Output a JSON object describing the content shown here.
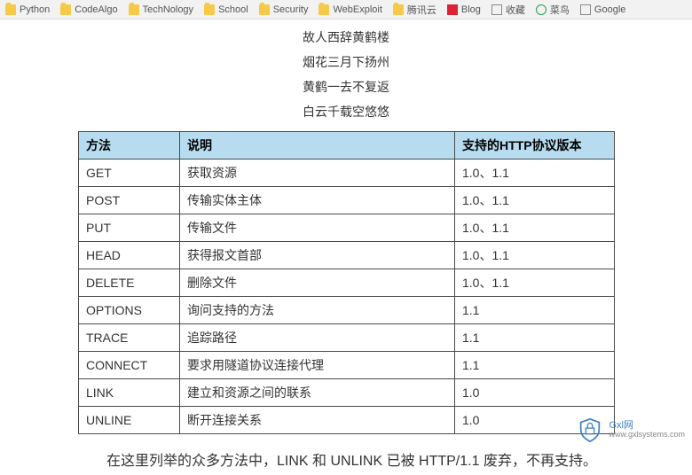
{
  "bookmarks": [
    {
      "name": "python",
      "label": "Python",
      "icon": "folder"
    },
    {
      "name": "codealgo",
      "label": "CodeAlgo",
      "icon": "folder"
    },
    {
      "name": "technology",
      "label": "TechNology",
      "icon": "folder"
    },
    {
      "name": "school",
      "label": "School",
      "icon": "folder"
    },
    {
      "name": "security",
      "label": "Security",
      "icon": "folder"
    },
    {
      "name": "webexploit",
      "label": "WebExploit",
      "icon": "folder"
    },
    {
      "name": "tencent",
      "label": "腾讯云",
      "icon": "folder"
    },
    {
      "name": "blog",
      "label": "Blog",
      "icon": "red"
    },
    {
      "name": "favorites",
      "label": "收藏",
      "icon": "outline"
    },
    {
      "name": "caoniao",
      "label": "菜鸟",
      "icon": "green"
    },
    {
      "name": "google",
      "label": "Google",
      "icon": "outline"
    }
  ],
  "poem": {
    "l1": "故人西辞黄鹤楼",
    "l2": "烟花三月下扬州",
    "l3": "黄鹤一去不复返",
    "l4": "白云千载空悠悠"
  },
  "table": {
    "headers": {
      "h1": "方法",
      "h2": "说明",
      "h3": "支持的HTTP协议版本"
    },
    "rows": [
      {
        "method": "GET",
        "desc": "获取资源",
        "ver": "1.0、1.1"
      },
      {
        "method": "POST",
        "desc": "传输实体主体",
        "ver": "1.0、1.1"
      },
      {
        "method": "PUT",
        "desc": "传输文件",
        "ver": "1.0、1.1"
      },
      {
        "method": "HEAD",
        "desc": "获得报文首部",
        "ver": "1.0、1.1"
      },
      {
        "method": "DELETE",
        "desc": "删除文件",
        "ver": "1.0、1.1"
      },
      {
        "method": "OPTIONS",
        "desc": "询问支持的方法",
        "ver": "1.1"
      },
      {
        "method": "TRACE",
        "desc": "追踪路径",
        "ver": "1.1"
      },
      {
        "method": "CONNECT",
        "desc": "要求用隧道协议连接代理",
        "ver": "1.1"
      },
      {
        "method": "LINK",
        "desc": "建立和资源之间的联系",
        "ver": "1.0"
      },
      {
        "method": "UNLINE",
        "desc": "断开连接关系",
        "ver": "1.0"
      }
    ]
  },
  "paragraph": "在这里列举的众多方法中，LINK 和 UNLINK 已被 HTTP/1.1 废弃，不再支持。",
  "brand": {
    "line1": "Gxl网",
    "line2": "www.gxlsystems.com"
  }
}
